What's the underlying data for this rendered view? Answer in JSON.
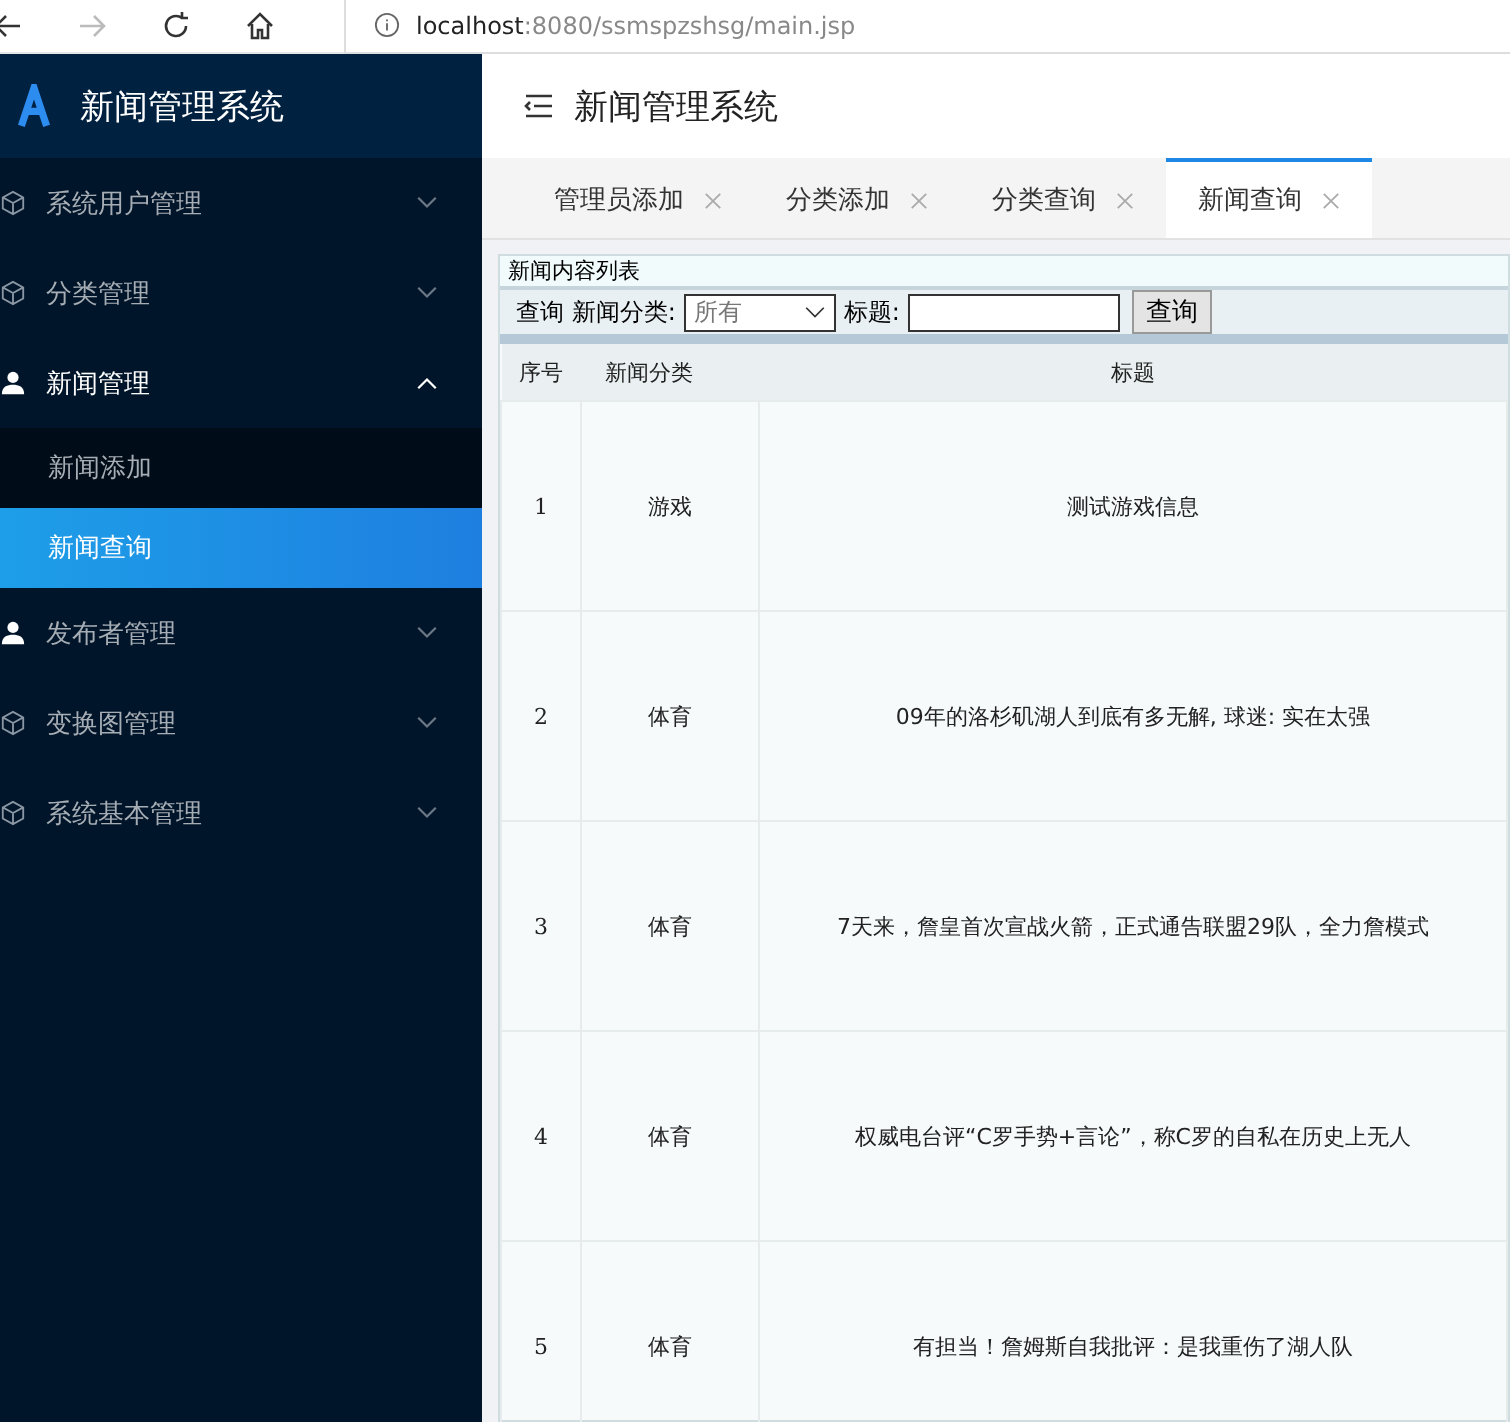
{
  "browser": {
    "url_host": "localhost",
    "url_path": ":8080/ssmspzshsg/main.jsp"
  },
  "sidebar": {
    "title": "新闻管理系统",
    "items": [
      {
        "label": "系统用户管理",
        "kind": "module",
        "expanded": false
      },
      {
        "label": "分类管理",
        "kind": "module",
        "expanded": false
      },
      {
        "label": "新闻管理",
        "kind": "person",
        "expanded": true,
        "children": [
          {
            "label": "新闻添加",
            "selected": false
          },
          {
            "label": "新闻查询",
            "selected": true
          }
        ]
      },
      {
        "label": "发布者管理",
        "kind": "person",
        "expanded": false
      },
      {
        "label": "变换图管理",
        "kind": "module",
        "expanded": false
      },
      {
        "label": "系统基本管理",
        "kind": "module",
        "expanded": false
      }
    ]
  },
  "header": {
    "title": "新闻管理系统"
  },
  "tabs": [
    {
      "label": "管理员添加",
      "selected": false
    },
    {
      "label": "分类添加",
      "selected": false
    },
    {
      "label": "分类查询",
      "selected": false
    },
    {
      "label": "新闻查询",
      "selected": true
    }
  ],
  "panel": {
    "title": "新闻内容列表",
    "search": {
      "prefix": "查询 新闻分类:",
      "category": "所有",
      "title_label": "标题:",
      "button": "查询"
    },
    "table": {
      "columns": [
        "序号",
        "新闻分类",
        "标题"
      ],
      "rows": [
        [
          "1",
          "游戏",
          "测试游戏信息"
        ],
        [
          "2",
          "体育",
          "09年的洛杉矶湖人到底有多无解, 球迷: 实在太强"
        ],
        [
          "3",
          "体育",
          "7天来，詹皇首次宣战火箭，正式通告联盟29队，全力詹模式"
        ],
        [
          "4",
          "体育",
          "权威电台评“C罗手势+言论”，称C罗的自私在历史上无人"
        ],
        [
          "5",
          "体育",
          "有担当！詹姆斯自我批评：是我重伤了湖人队"
        ]
      ]
    }
  }
}
